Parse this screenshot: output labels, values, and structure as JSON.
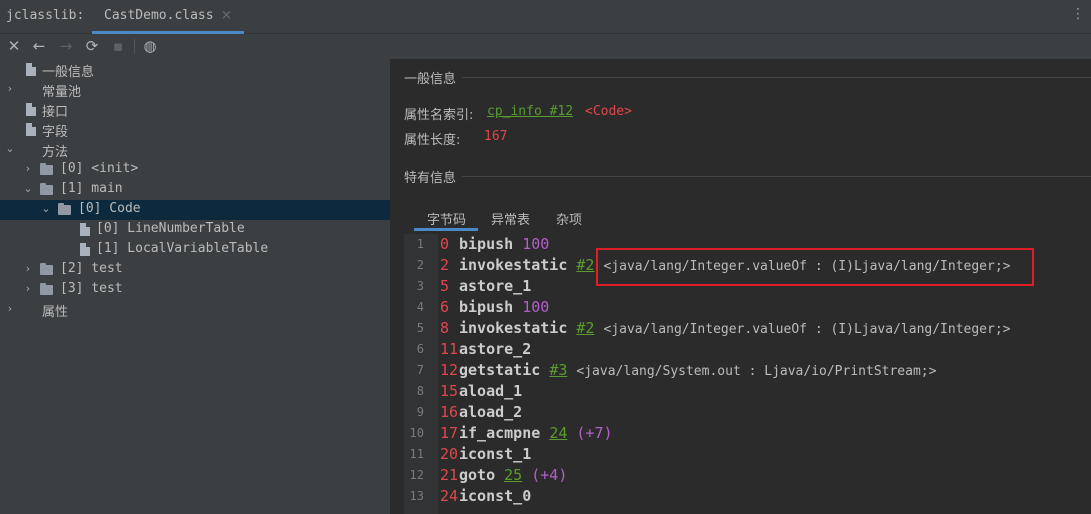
{
  "tabbar": {
    "tool_title": "jclasslib:",
    "active_tab": "CastDemo.class",
    "close_glyph": "×",
    "menu_glyph": "⋮"
  },
  "toolbar": {
    "close_icon": "✕",
    "back_icon": "←",
    "forward_icon": "→",
    "refresh_icon": "⟳",
    "save_icon": "▪",
    "web_icon": "◍"
  },
  "tree": {
    "items": [
      {
        "label": "一般信息",
        "depth": 0,
        "kind": "file",
        "arrow": ""
      },
      {
        "label": "常量池",
        "depth": 0,
        "kind": "none",
        "arrow": "›"
      },
      {
        "label": "接口",
        "depth": 0,
        "kind": "file",
        "arrow": ""
      },
      {
        "label": "字段",
        "depth": 0,
        "kind": "file",
        "arrow": ""
      },
      {
        "label": "方法",
        "depth": 0,
        "kind": "none",
        "arrow": "⌄"
      },
      {
        "label": "[0] <init>",
        "depth": 1,
        "kind": "folder",
        "arrow": "›"
      },
      {
        "label": "[1] main",
        "depth": 1,
        "kind": "folder",
        "arrow": "⌄"
      },
      {
        "label": "[0] Code",
        "depth": 2,
        "kind": "folder",
        "arrow": "⌄",
        "selected": true
      },
      {
        "label": "[0] LineNumberTable",
        "depth": 3,
        "kind": "file",
        "arrow": ""
      },
      {
        "label": "[1] LocalVariableTable",
        "depth": 3,
        "kind": "file",
        "arrow": ""
      },
      {
        "label": "[2] test",
        "depth": 1,
        "kind": "folder",
        "arrow": "›"
      },
      {
        "label": "[3] test",
        "depth": 1,
        "kind": "folder",
        "arrow": "›"
      },
      {
        "label": "属性",
        "depth": 0,
        "kind": "none",
        "arrow": "›"
      }
    ]
  },
  "general_info": {
    "title": "一般信息",
    "name_index_label": "属性名索引:",
    "name_index_link": "cp_info #12",
    "name_index_value": "<Code>",
    "length_label": "属性长度:",
    "length_value": "167"
  },
  "specific_info": {
    "title": "特有信息",
    "tabs": [
      "字节码",
      "异常表",
      "杂项"
    ]
  },
  "bytecode": [
    {
      "ln": "1",
      "off": "0",
      "op": "bipush",
      "num": "100",
      "ref": "",
      "jump": "",
      "cmt": ""
    },
    {
      "ln": "2",
      "off": "2",
      "op": "invokestatic",
      "num": "",
      "ref": "#2",
      "jump": "",
      "cmt": "<java/lang/Integer.valueOf : (I)Ljava/lang/Integer;>"
    },
    {
      "ln": "3",
      "off": "5",
      "op": "astore_1",
      "num": "",
      "ref": "",
      "jump": "",
      "cmt": ""
    },
    {
      "ln": "4",
      "off": "6",
      "op": "bipush",
      "num": "100",
      "ref": "",
      "jump": "",
      "cmt": ""
    },
    {
      "ln": "5",
      "off": "8",
      "op": "invokestatic",
      "num": "",
      "ref": "#2",
      "jump": "",
      "cmt": "<java/lang/Integer.valueOf : (I)Ljava/lang/Integer;>"
    },
    {
      "ln": "6",
      "off": "11",
      "op": "astore_2",
      "num": "",
      "ref": "",
      "jump": "",
      "cmt": ""
    },
    {
      "ln": "7",
      "off": "12",
      "op": "getstatic",
      "num": "",
      "ref": "#3",
      "jump": "",
      "cmt": "<java/lang/System.out : Ljava/io/PrintStream;>"
    },
    {
      "ln": "8",
      "off": "15",
      "op": "aload_1",
      "num": "",
      "ref": "",
      "jump": "",
      "cmt": ""
    },
    {
      "ln": "9",
      "off": "16",
      "op": "aload_2",
      "num": "",
      "ref": "",
      "jump": "",
      "cmt": ""
    },
    {
      "ln": "10",
      "off": "17",
      "op": "if_acmpne",
      "num": "",
      "ref": "24",
      "jump": "(+7)",
      "cmt": ""
    },
    {
      "ln": "11",
      "off": "20",
      "op": "iconst_1",
      "num": "",
      "ref": "",
      "jump": "",
      "cmt": ""
    },
    {
      "ln": "12",
      "off": "21",
      "op": "goto",
      "num": "",
      "ref": "25",
      "jump": "(+4)",
      "cmt": ""
    },
    {
      "ln": "13",
      "off": "24",
      "op": "iconst_0",
      "num": "",
      "ref": "",
      "jump": "",
      "cmt": ""
    }
  ],
  "colors": {
    "accent": "#4a88c7",
    "highlight_box": "#e01e25",
    "offset_red": "#e0474c",
    "link_green": "#5a9c2f",
    "number_purple": "#b35fca"
  }
}
